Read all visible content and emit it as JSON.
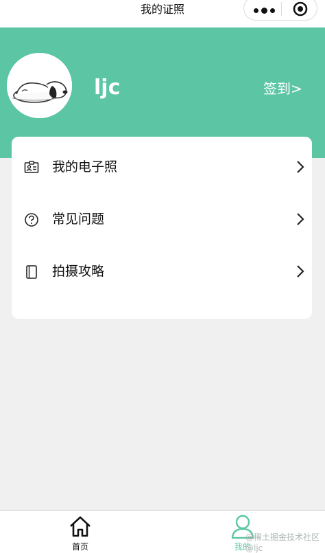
{
  "navbar": {
    "title": "我的证照"
  },
  "colors": {
    "brand_green": "#5cc6a4",
    "background": "#f0f0f0"
  },
  "profile": {
    "username": "ljc",
    "signin_label": "签到>"
  },
  "menu": [
    {
      "label": "我的电子照",
      "icon": "id-card-icon"
    },
    {
      "label": "常见问题",
      "icon": "question-circle-icon"
    },
    {
      "label": "拍摄攻略",
      "icon": "book-icon"
    }
  ],
  "tabbar": [
    {
      "label": "首页",
      "icon": "home-icon",
      "active": false
    },
    {
      "label": "我的",
      "icon": "user-icon",
      "active": true
    }
  ],
  "watermark": "@稀土掘金技术社区 @ljc"
}
